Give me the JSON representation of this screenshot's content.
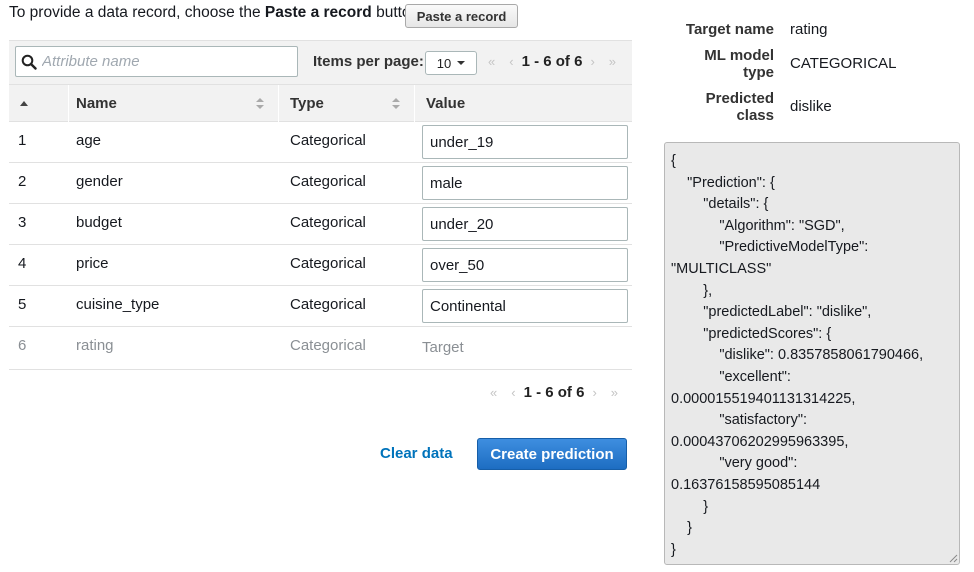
{
  "intro": {
    "prefix": "To provide a data record, choose the ",
    "bold": "Paste a record",
    "suffix": " button."
  },
  "paste_button": "Paste a record",
  "toolbar": {
    "search_placeholder": "Attribute name",
    "items_per_page_label": "Items per page:",
    "items_per_page_value": "10",
    "pagination": "1 - 6 of 6"
  },
  "columns": {
    "name": "Name",
    "type": "Type",
    "value": "Value"
  },
  "rows": [
    {
      "index": "1",
      "name": "age",
      "type": "Categorical",
      "value": "under_19"
    },
    {
      "index": "2",
      "name": "gender",
      "type": "Categorical",
      "value": "male"
    },
    {
      "index": "3",
      "name": "budget",
      "type": "Categorical",
      "value": "under_20"
    },
    {
      "index": "4",
      "name": "price",
      "type": "Categorical",
      "value": "over_50"
    },
    {
      "index": "5",
      "name": "cuisine_type",
      "type": "Categorical",
      "value": "Continental"
    },
    {
      "index": "6",
      "name": "rating",
      "type": "Categorical",
      "value": "Target"
    }
  ],
  "bottom_pagination": "1 - 6 of 6",
  "actions": {
    "clear": "Clear data",
    "create": "Create prediction"
  },
  "summary": {
    "target_name_label": "Target name",
    "target_name_value": "rating",
    "ml_model_type_label_1": "ML model",
    "ml_model_type_label_2": "type",
    "ml_model_type_value": "CATEGORICAL",
    "predicted_class_label_1": "Predicted",
    "predicted_class_label_2": "class",
    "predicted_class_value": "dislike"
  },
  "prediction_json": "{\n    \"Prediction\": {\n        \"details\": {\n            \"Algorithm\": \"SGD\",\n            \"PredictiveModelType\": \n\"MULTICLASS\"\n        },\n        \"predictedLabel\": \"dislike\",\n        \"predictedScores\": {\n            \"dislike\": 0.8357858061790466,\n            \"excellent\": \n0.000015519401131314225,\n            \"satisfactory\": \n0.00043706202995963395,\n            \"very good\": \n0.16376158595085144\n        }\n    }\n}",
  "colors": {
    "primary": "#1d6dc2",
    "link": "#0073bb",
    "header_bg": "#f2f2f2"
  }
}
